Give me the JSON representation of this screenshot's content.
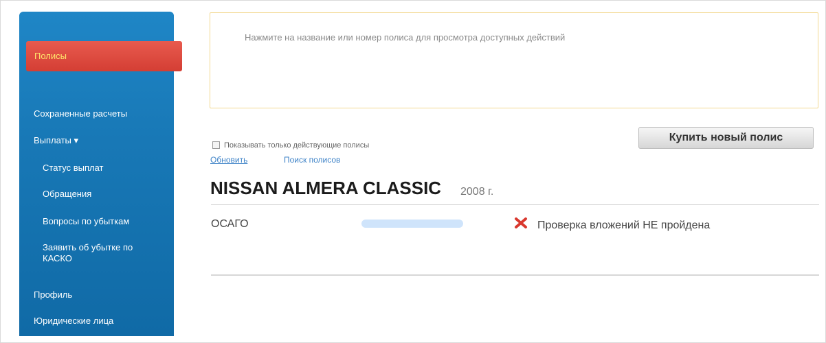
{
  "sidebar": {
    "items": [
      {
        "label": "Полисы",
        "active": true
      },
      {
        "label": "Сохраненные расчеты"
      },
      {
        "label": "Выплаты ▾"
      },
      {
        "label": "Статус выплат"
      },
      {
        "label": "Обращения"
      },
      {
        "label": "Вопросы по убыткам"
      },
      {
        "label": "Заявить об убытке по КАСКО"
      },
      {
        "label": "Профиль"
      },
      {
        "label": "Юридические лица"
      }
    ]
  },
  "info": {
    "message": "Нажмите на название или номер полиса для просмотра доступных действий"
  },
  "filters": {
    "show_active_label": "Показывать только действующие полисы",
    "show_active_checked": false
  },
  "actions": {
    "buy_label": "Купить новый полис",
    "refresh_label": "Обновить",
    "search_label": "Поиск полисов"
  },
  "vehicle": {
    "title": "NISSAN ALMERA CLASSIC",
    "year": "2008 г."
  },
  "policy": {
    "type": "ОСАГО",
    "status": "Проверка вложений НЕ пройдена",
    "status_color": "#d9382e"
  }
}
